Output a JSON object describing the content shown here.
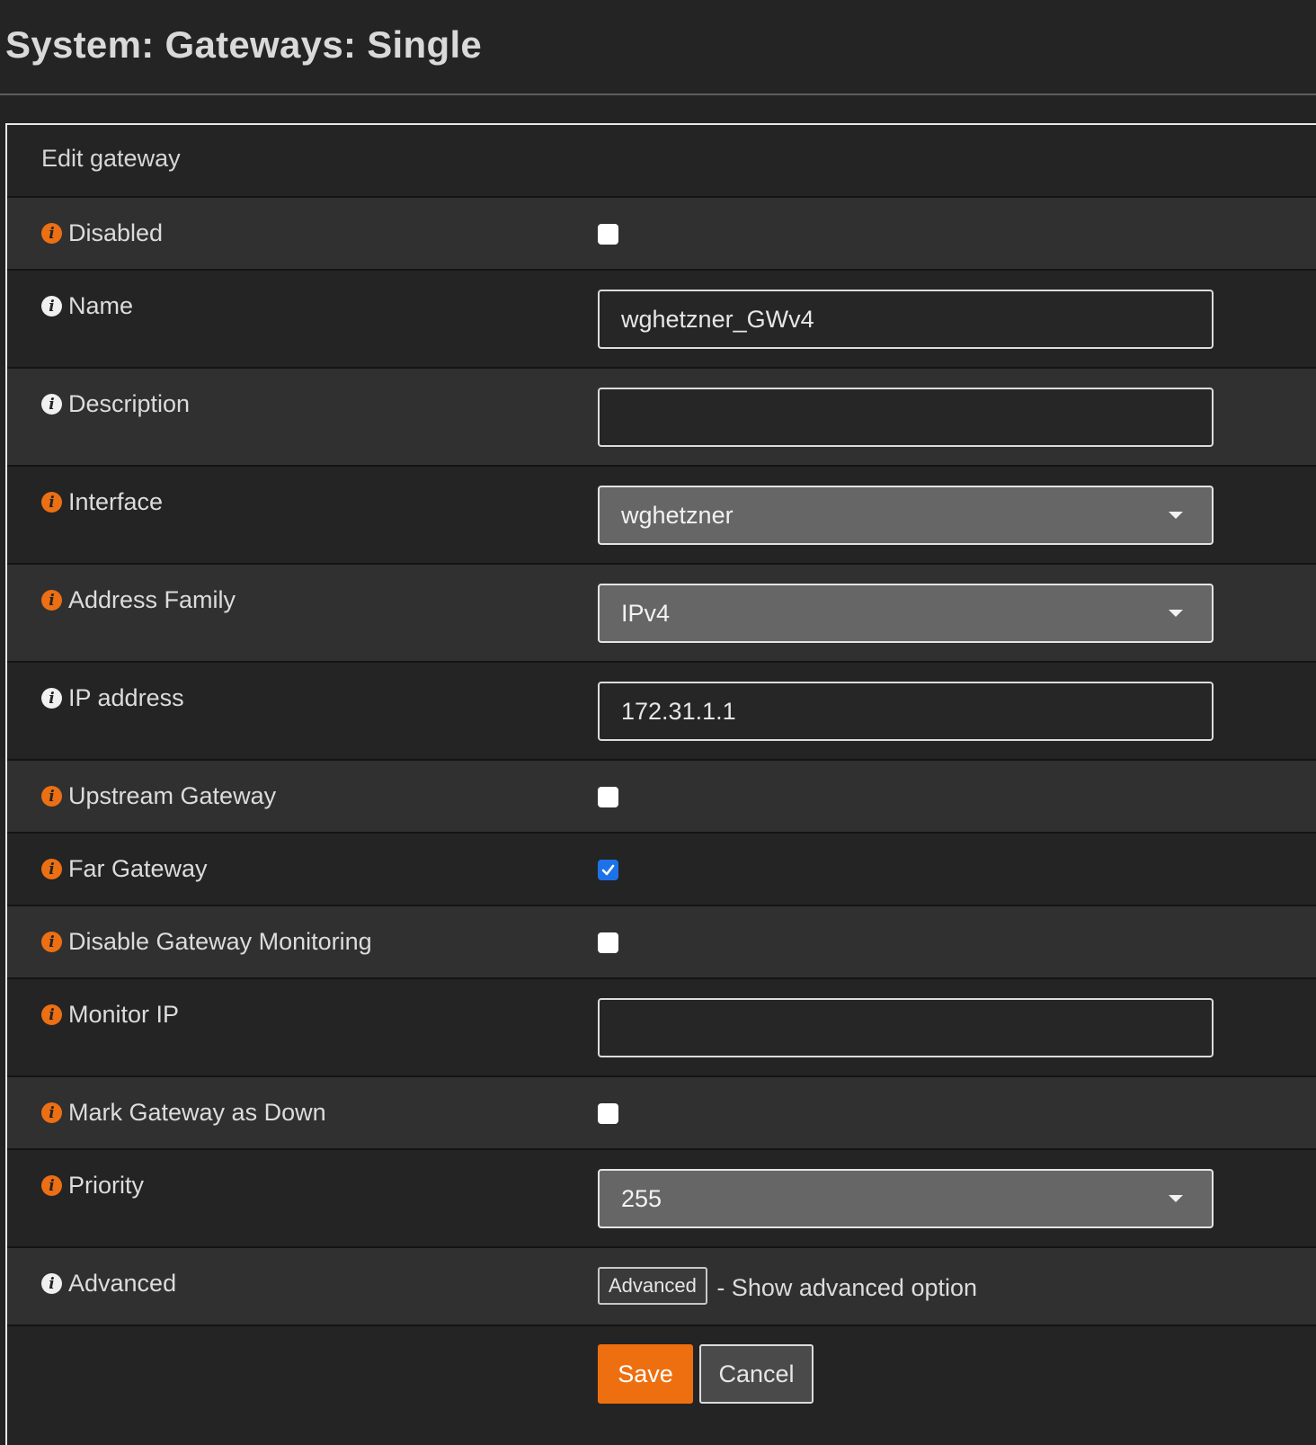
{
  "page": {
    "title": "System: Gateways: Single"
  },
  "panel": {
    "heading": "Edit gateway"
  },
  "fields": {
    "disabled": {
      "label": "Disabled",
      "checked": false
    },
    "name": {
      "label": "Name",
      "value": "wghetzner_GWv4"
    },
    "description": {
      "label": "Description",
      "value": ""
    },
    "interface": {
      "label": "Interface",
      "value": "wghetzner"
    },
    "address_family": {
      "label": "Address Family",
      "value": "IPv4"
    },
    "ip_address": {
      "label": "IP address",
      "value": "172.31.1.1"
    },
    "upstream_gateway": {
      "label": "Upstream Gateway",
      "checked": false
    },
    "far_gateway": {
      "label": "Far Gateway",
      "checked": true
    },
    "disable_monitoring": {
      "label": "Disable Gateway Monitoring",
      "checked": false
    },
    "monitor_ip": {
      "label": "Monitor IP",
      "value": ""
    },
    "mark_down": {
      "label": "Mark Gateway as Down",
      "checked": false
    },
    "priority": {
      "label": "Priority",
      "value": "255"
    },
    "advanced": {
      "label": "Advanced",
      "button_label": "Advanced",
      "help": "- Show advanced option"
    }
  },
  "actions": {
    "save_label": "Save",
    "cancel_label": "Cancel"
  },
  "colors": {
    "accent": "#ee6f10",
    "checkbox_checked": "#1d72e8",
    "background": "#232323"
  }
}
